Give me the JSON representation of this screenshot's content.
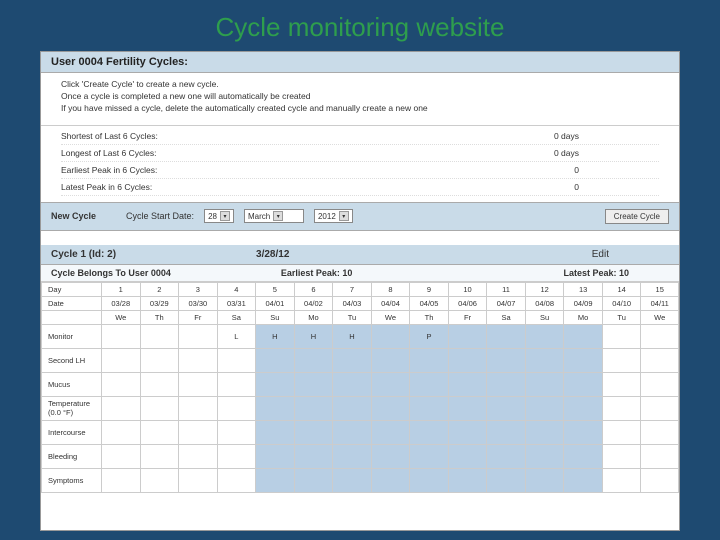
{
  "title": "Cycle monitoring website",
  "header": "User 0004 Fertility Cycles:",
  "instructions": [
    "Click 'Create Cycle' to create a new cycle.",
    "Once a cycle is completed a new one will automatically be created",
    "If you have missed a cycle, delete the automatically created cycle and manually create a new one"
  ],
  "stats": [
    {
      "label": "Shortest of Last 6 Cycles:",
      "value": "0 days"
    },
    {
      "label": "Longest of Last 6 Cycles:",
      "value": "0 days"
    },
    {
      "label": "Earliest Peak in 6 Cycles:",
      "value": "0"
    },
    {
      "label": "Latest Peak in 6 Cycles:",
      "value": "0"
    }
  ],
  "newcycle": {
    "label": "New Cycle",
    "startlabel": "Cycle Start Date:",
    "day": "28",
    "month": "March",
    "year": "2012",
    "btn": "Create Cycle"
  },
  "cycle": {
    "name": "Cycle 1 (Id: 2)",
    "date": "3/28/12",
    "edit": "Edit",
    "belongs": "Cycle Belongs To User 0004",
    "earliest": "Earliest Peak: 10",
    "latest": "Latest Peak: 10"
  },
  "rows": {
    "day": [
      "Day",
      "1",
      "2",
      "3",
      "4",
      "5",
      "6",
      "7",
      "8",
      "9",
      "10",
      "11",
      "12",
      "13",
      "14",
      "15"
    ],
    "date": [
      "Date",
      "03/28",
      "03/29",
      "03/30",
      "03/31",
      "04/01",
      "04/02",
      "04/03",
      "04/04",
      "04/05",
      "04/06",
      "04/07",
      "04/08",
      "04/09",
      "04/10",
      "04/11"
    ],
    "dow": [
      "",
      "We",
      "Th",
      "Fr",
      "Sa",
      "Su",
      "Mo",
      "Tu",
      "We",
      "Th",
      "Fr",
      "Sa",
      "Su",
      "Mo",
      "Tu",
      "We"
    ],
    "monitor": [
      "Monitor",
      "",
      "",
      "",
      "L",
      "H",
      "H",
      "H",
      "",
      "P",
      "",
      "",
      "",
      "",
      "",
      ""
    ]
  },
  "side": [
    "Second LH",
    "Mucus",
    "Temperature (0.0 °F)",
    "Intercourse",
    "Bleeding",
    "Symptoms"
  ]
}
